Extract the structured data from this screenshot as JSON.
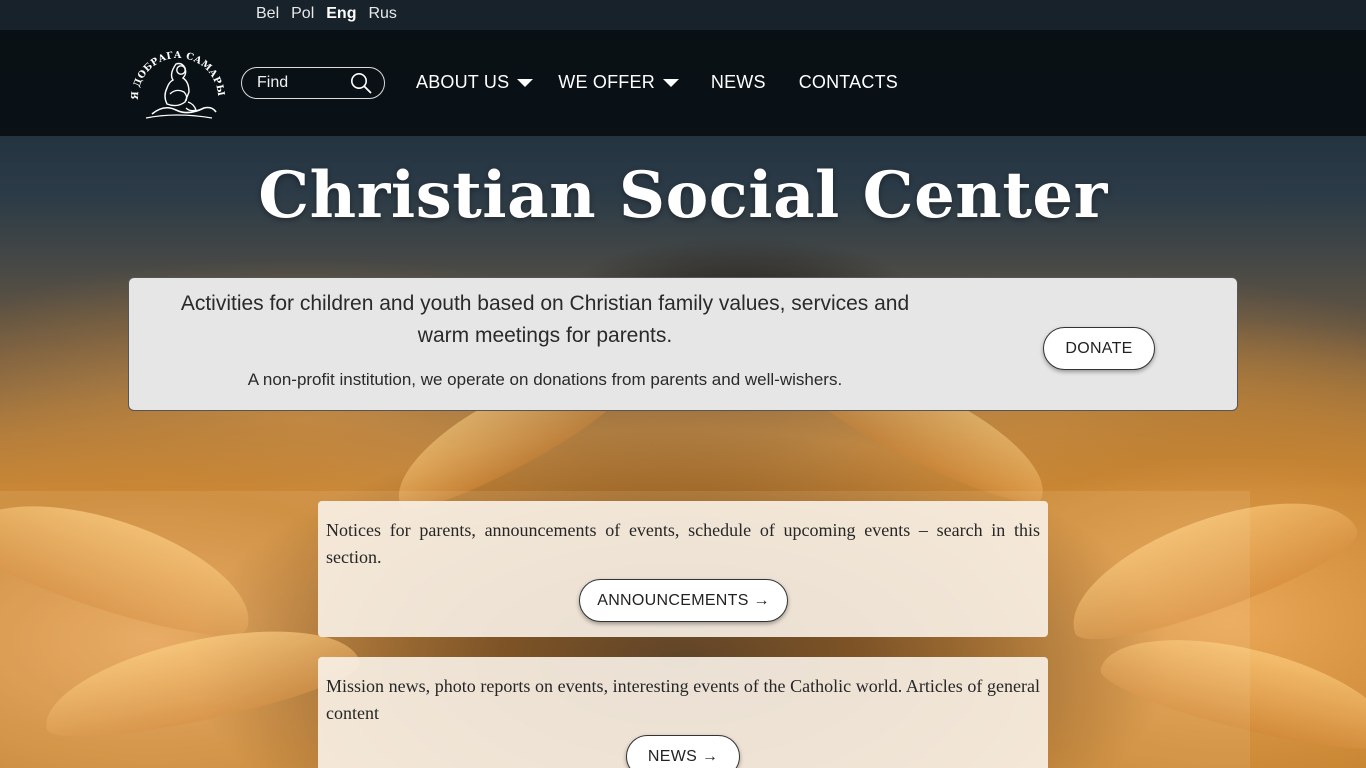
{
  "languages": [
    {
      "label": "Bel",
      "active": false
    },
    {
      "label": "Pol",
      "active": false
    },
    {
      "label": "Eng",
      "active": true
    },
    {
      "label": "Rus",
      "active": false
    }
  ],
  "header": {
    "logo_text": "МІСІЯ ДОБРАГА САМАРЫНІНА",
    "search": {
      "placeholder": "Find"
    },
    "nav": [
      {
        "label": "ABOUT US",
        "has_dropdown": true
      },
      {
        "label": "WE OFFER",
        "has_dropdown": true
      },
      {
        "label": "NEWS",
        "has_dropdown": false
      },
      {
        "label": "CONTACTS",
        "has_dropdown": false
      }
    ]
  },
  "hero": {
    "title": "Christian Social Center",
    "lead": "Activities for children and youth based on Christian family values, services and warm meetings for parents.",
    "sub": "A non-profit institution, we operate on donations from parents and well-wishers.",
    "donate_label": "DONATE"
  },
  "sections": [
    {
      "text": "Notices for parents, announcements of events, schedule of upcoming events – search in this section.",
      "button_label": "ANNOUNCEMENTS →"
    },
    {
      "text": "Mission news, photo reports on events, interesting events of the Catholic world. Articles of general content",
      "button_label": "NEWS →"
    }
  ],
  "colors": {
    "header_bg": "#05090e",
    "langbar_bg": "#18222b",
    "hero_box_bg": "#e6e6e6",
    "card_bg": "#faf2e8",
    "accent_sunflower": "#d99a4a"
  }
}
